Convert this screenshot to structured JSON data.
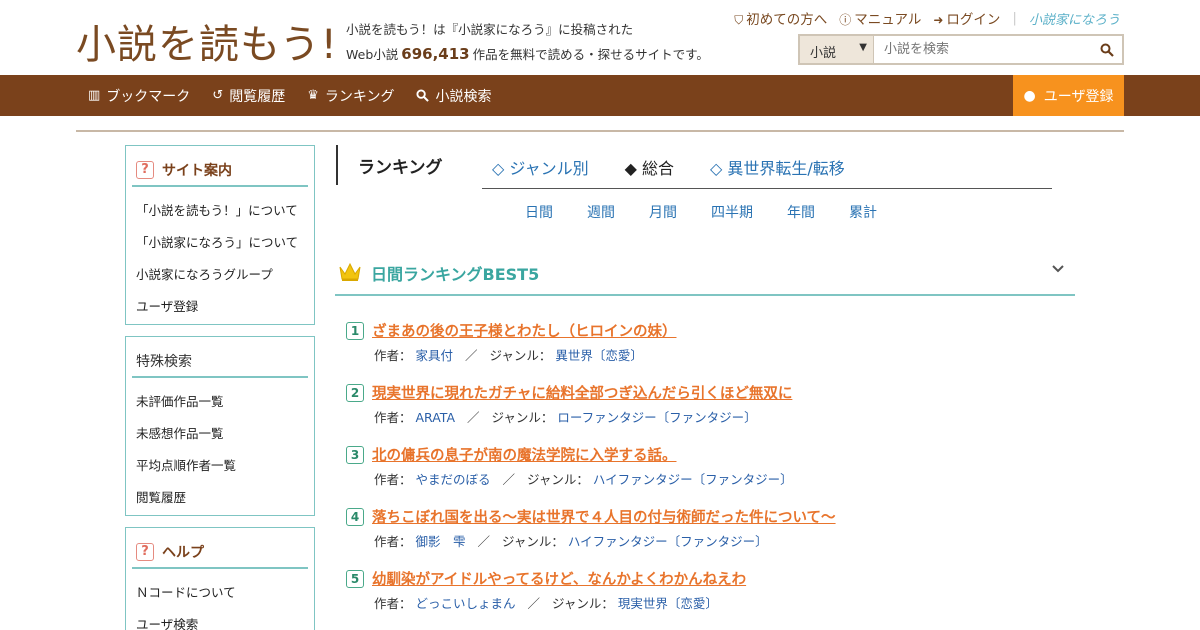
{
  "header": {
    "logo": "小説を読もう!",
    "tagline_line1": "小説を読もう！は『小説家になろう』に投稿された",
    "tagline_prefix": "Web小説",
    "work_count": "696,413",
    "tagline_suffix": "作品を無料で読める・探せるサイトです。",
    "links": [
      {
        "label": "初めての方へ"
      },
      {
        "label": "マニュアル"
      },
      {
        "label": "ログイン"
      }
    ],
    "brand": "小説家になろう",
    "search": {
      "category": "小説",
      "placeholder": "小説を検索"
    }
  },
  "nav": {
    "items": [
      {
        "label": "ブックマーク"
      },
      {
        "label": "閲覧履歴"
      },
      {
        "label": "ランキング"
      },
      {
        "label": "小説検索"
      }
    ],
    "register": "ユーザ登録"
  },
  "sidebar": {
    "guide": {
      "title": "サイト案内",
      "items": [
        "「小説を読もう！」について",
        "「小説家になろう」について",
        "小説家になろうグループ",
        "ユーザ登録"
      ]
    },
    "special": {
      "title": "特殊検索",
      "items": [
        "未評価作品一覧",
        "未感想作品一覧",
        "平均点順作者一覧",
        "閲覧履歴"
      ]
    },
    "help": {
      "title": "ヘルプ",
      "items": [
        "Ｎコードについて",
        "ユーザ検索"
      ]
    }
  },
  "ranking": {
    "title": "ランキング",
    "tabs": [
      "◇ ジャンル別",
      "◆ 総合",
      "◇ 異世界転生/転移"
    ],
    "periods": [
      "日間",
      "週間",
      "月間",
      "四半期",
      "年間",
      "累計"
    ],
    "best_title": "日間ランキングBEST5",
    "author_label": "作者：",
    "genre_label": "ジャンル：",
    "slash": "／",
    "entries": [
      {
        "rank": "1",
        "title": "ざまあの後の王子様とわたし（ヒロインの妹）",
        "author": "家具付",
        "genre": "異世界〔恋愛〕"
      },
      {
        "rank": "2",
        "title": "現実世界に現れたガチャに給料全部つぎ込んだら引くほど無双に",
        "author": "ARATA",
        "genre": "ローファンタジー〔ファンタジー〕"
      },
      {
        "rank": "3",
        "title": "北の傭兵の息子が南の魔法学院に入学する話。",
        "author": "やまだのぼる",
        "genre": "ハイファンタジー〔ファンタジー〕"
      },
      {
        "rank": "4",
        "title": "落ちこぼれ国を出る～実は世界で４人目の付与術師だった件について～",
        "author": "御影　雫",
        "genre": "ハイファンタジー〔ファンタジー〕"
      },
      {
        "rank": "5",
        "title": "幼馴染がアイドルやってるけど、なんかよくわかんねえわ",
        "author": "どっこいしょまん",
        "genre": "現実世界〔恋愛〕"
      }
    ]
  }
}
